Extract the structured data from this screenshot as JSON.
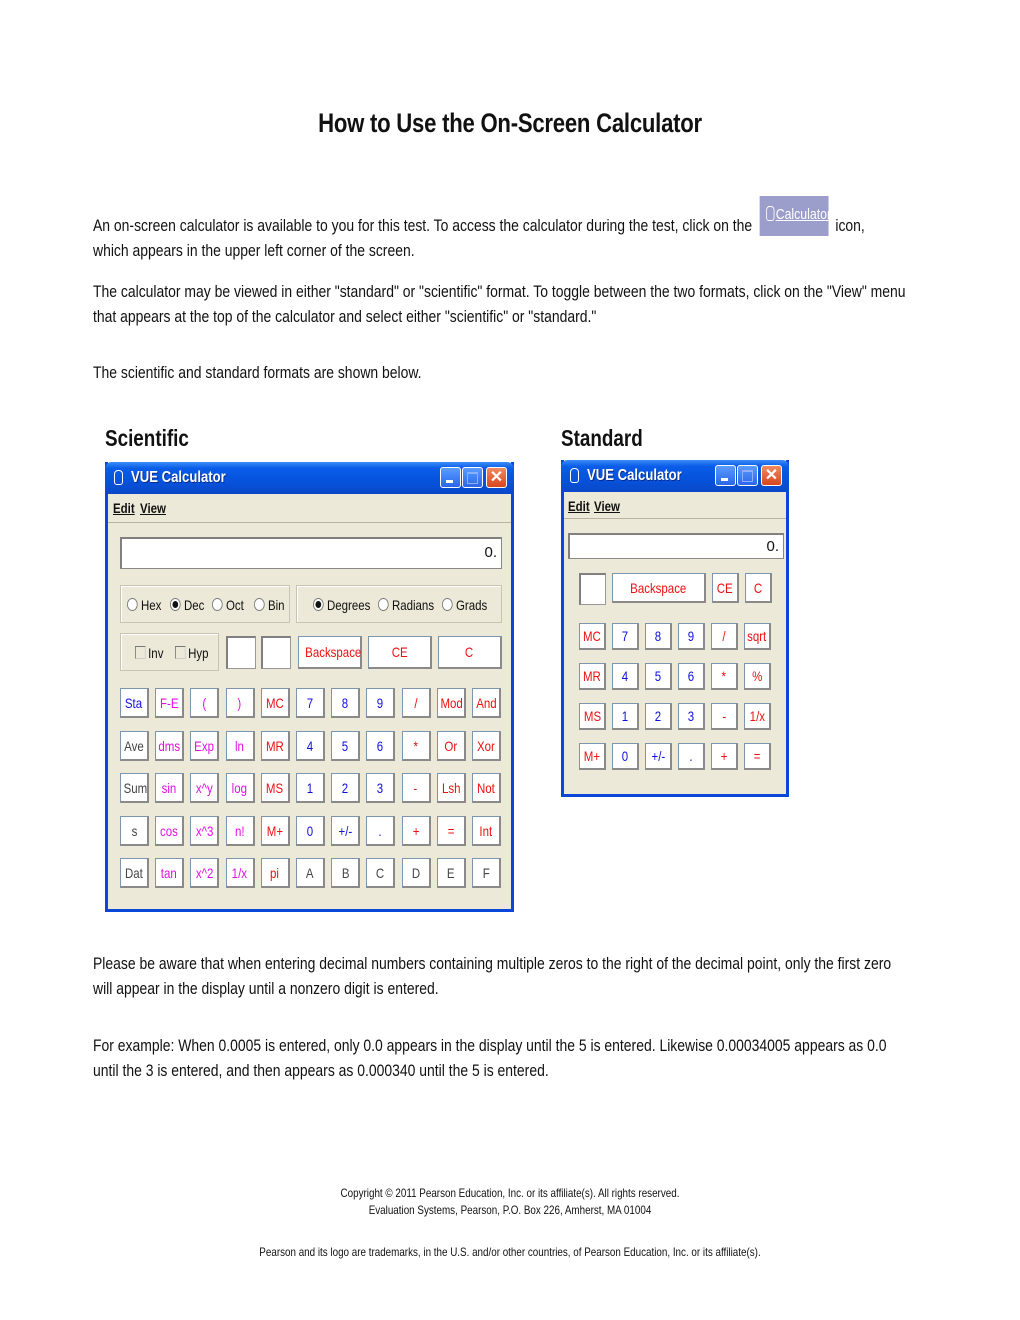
{
  "title": "How to Use the On-Screen Calculator",
  "intro": {
    "line1_before": "An on-screen calculator is available to you for this test. To access the calculator during the test, click on the",
    "calculator_button_label": "Calculator",
    "calculator_button_icon": "calculator-cylinder-icon",
    "line1_after": "icon,",
    "line2": "which appears in the upper left corner of the screen."
  },
  "toggle_paragraph": {
    "line1": "The calculator may be viewed in either \"standard\" or \"scientific\" format. To toggle between the two formats, click on the \"View\" menu",
    "line2": "that appears at the top of the calculator and select either \"scientific\" or \"standard.\""
  },
  "formats_intro": "The scientific and standard formats are shown below.",
  "scientific": {
    "section_label": "Scientific",
    "window_title": "VUE Calculator",
    "menu": [
      "Edit",
      "View"
    ],
    "display_value": "0.",
    "number_system": [
      {
        "label": "Hex",
        "selected": false
      },
      {
        "label": "Dec",
        "selected": true
      },
      {
        "label": "Oct",
        "selected": false
      },
      {
        "label": "Bin",
        "selected": false
      }
    ],
    "angle_units": [
      {
        "label": "Degrees",
        "selected": true
      },
      {
        "label": "Radians",
        "selected": false
      },
      {
        "label": "Grads",
        "selected": false
      }
    ],
    "checkboxes": [
      {
        "label": "Inv",
        "checked": false
      },
      {
        "label": "Hyp",
        "checked": false
      }
    ],
    "top_keys": [
      "Backspace",
      "CE",
      "C"
    ],
    "key_rows": [
      [
        [
          "Sta",
          "blue"
        ],
        [
          "F-E",
          "mag"
        ],
        [
          "(",
          "mag"
        ],
        [
          ")",
          "mag"
        ],
        [
          "MC",
          "red"
        ],
        [
          "7",
          "blue"
        ],
        [
          "8",
          "blue"
        ],
        [
          "9",
          "blue"
        ],
        [
          "/",
          "red"
        ],
        [
          "Mod",
          "red"
        ],
        [
          "And",
          "red"
        ]
      ],
      [
        [
          "Ave",
          "gray"
        ],
        [
          "dms",
          "mag"
        ],
        [
          "Exp",
          "mag"
        ],
        [
          "ln",
          "mag"
        ],
        [
          "MR",
          "red"
        ],
        [
          "4",
          "blue"
        ],
        [
          "5",
          "blue"
        ],
        [
          "6",
          "blue"
        ],
        [
          "*",
          "red"
        ],
        [
          "Or",
          "red"
        ],
        [
          "Xor",
          "red"
        ]
      ],
      [
        [
          "Sum",
          "gray"
        ],
        [
          "sin",
          "mag"
        ],
        [
          "x^y",
          "mag"
        ],
        [
          "log",
          "mag"
        ],
        [
          "MS",
          "red"
        ],
        [
          "1",
          "blue"
        ],
        [
          "2",
          "blue"
        ],
        [
          "3",
          "blue"
        ],
        [
          "-",
          "red"
        ],
        [
          "Lsh",
          "red"
        ],
        [
          "Not",
          "red"
        ]
      ],
      [
        [
          "s",
          "gray"
        ],
        [
          "cos",
          "mag"
        ],
        [
          "x^3",
          "mag"
        ],
        [
          "n!",
          "mag"
        ],
        [
          "M+",
          "red"
        ],
        [
          "0",
          "blue"
        ],
        [
          "+/-",
          "blue"
        ],
        [
          ".",
          "blue"
        ],
        [
          "+",
          "red"
        ],
        [
          "=",
          "red"
        ],
        [
          "Int",
          "red"
        ]
      ],
      [
        [
          "Dat",
          "gray"
        ],
        [
          "tan",
          "mag"
        ],
        [
          "x^2",
          "mag"
        ],
        [
          "1/x",
          "mag"
        ],
        [
          "pi",
          "red"
        ],
        [
          "A",
          "gray"
        ],
        [
          "B",
          "gray"
        ],
        [
          "C",
          "gray"
        ],
        [
          "D",
          "gray"
        ],
        [
          "E",
          "gray"
        ],
        [
          "F",
          "gray"
        ]
      ]
    ]
  },
  "standard": {
    "section_label": "Standard",
    "window_title": "VUE Calculator",
    "menu": [
      "Edit",
      "View"
    ],
    "display_value": "0.",
    "top_keys": [
      "Backspace",
      "CE",
      "C"
    ],
    "key_rows": [
      [
        [
          "MC",
          "red"
        ],
        [
          "7",
          "blue"
        ],
        [
          "8",
          "blue"
        ],
        [
          "9",
          "blue"
        ],
        [
          "/",
          "red"
        ],
        [
          "sqrt",
          "red"
        ]
      ],
      [
        [
          "MR",
          "red"
        ],
        [
          "4",
          "blue"
        ],
        [
          "5",
          "blue"
        ],
        [
          "6",
          "blue"
        ],
        [
          "*",
          "red"
        ],
        [
          "%",
          "red"
        ]
      ],
      [
        [
          "MS",
          "red"
        ],
        [
          "1",
          "blue"
        ],
        [
          "2",
          "blue"
        ],
        [
          "3",
          "blue"
        ],
        [
          "-",
          "red"
        ],
        [
          "1/x",
          "red"
        ]
      ],
      [
        [
          "M+",
          "red"
        ],
        [
          "0",
          "blue"
        ],
        [
          "+/-",
          "blue"
        ],
        [
          ".",
          "blue"
        ],
        [
          "+",
          "red"
        ],
        [
          "=",
          "red"
        ]
      ]
    ]
  },
  "zeros_paragraph": {
    "line1": "Please be aware that when entering decimal numbers containing multiple zeros to the right of the decimal point, only the first zero",
    "line2": "will appear in the display until a nonzero digit is entered."
  },
  "example_paragraph": {
    "line1": "For example:  When 0.0005 is entered, only 0.0 appears in the display until the 5 is entered.  Likewise 0.00034005 appears as 0.0",
    "line2": "until the 3 is entered, and then appears as 0.000340 until the 5 is entered."
  },
  "footer": {
    "copyright": "Copyright © 2011 Pearson Education, Inc. or its affiliate(s). All rights reserved.",
    "address": "Evaluation Systems, Pearson, P.O. Box 226, Amherst, MA 01004",
    "trademark": "Pearson and its logo are trademarks, in the U.S. and/or other countries, of Pearson Education, Inc. or its affiliate(s)."
  },
  "colors": {
    "blue": "#1010e0",
    "red": "#ee1010",
    "mag": "#e010e0",
    "gray": "#444444",
    "titlebar": "#0653dc",
    "window_bg": "#ece9d8",
    "calc_button_bg": "#9b9dcb"
  }
}
